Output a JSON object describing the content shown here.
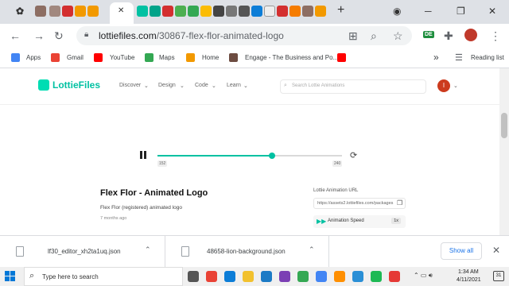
{
  "browser": {
    "active_tab_close": "✕",
    "new_tab": "+",
    "url_host": "lottiefiles.com",
    "url_path": "/30867-flex-flor-animated-logo",
    "bookmarks": [
      {
        "label": "Apps",
        "color": "#4285f4"
      },
      {
        "label": "Gmail",
        "color": "#ea4335"
      },
      {
        "label": "YouTube",
        "color": "#ff0000"
      },
      {
        "label": "Maps",
        "color": "#34a853"
      },
      {
        "label": "Home",
        "color": "#f29900"
      },
      {
        "label": "Engage - The Business and Po...",
        "color": "#6d4c41"
      }
    ],
    "more_bookmarks": "»",
    "reading_list": "Reading list",
    "profile_badge": "DE"
  },
  "lottie": {
    "logo": "LottieFiles",
    "menu": [
      "Discover",
      "Design",
      "Code",
      "Learn"
    ],
    "search_placeholder": "Search Lottie Animations",
    "avatar_letter": "I",
    "player": {
      "start_frame": "152",
      "end_frame": "240",
      "progress": 0.62
    },
    "animation_title": "Flex Flor - Animated Logo",
    "animation_description": "Flex Flor (registered) animated logo",
    "animation_age": "7 months ago",
    "url_label": "Lottie Animation URL",
    "url_value": "https://assets2.lottiefiles.com/packages",
    "speed_label": "Animation Speed",
    "speed_value": "1x"
  },
  "downloads": {
    "items": [
      {
        "name": "lf30_editor_xh2ta1uq.json"
      },
      {
        "name": "48658-lion-background.json"
      }
    ],
    "show_all": "Show all"
  },
  "taskbar": {
    "search_placeholder": "Type here to search",
    "time": "1:34 AM",
    "date": "4/11/2021",
    "notifications": "31",
    "apps": [
      {
        "name": "task-view",
        "color": "#555555"
      },
      {
        "name": "chrome",
        "color": "#e94235"
      },
      {
        "name": "edge",
        "color": "#0c7dd7"
      },
      {
        "name": "file-explorer",
        "color": "#f2c12e"
      },
      {
        "name": "vscode",
        "color": "#1b7ac5"
      },
      {
        "name": "visual-studio",
        "color": "#7b3fb4"
      },
      {
        "name": "maps",
        "color": "#34a853"
      },
      {
        "name": "chrome-alt",
        "color": "#4285f4"
      },
      {
        "name": "sublime",
        "color": "#ff8f00"
      },
      {
        "name": "photos",
        "color": "#2a8fd6"
      },
      {
        "name": "spotify",
        "color": "#1db954"
      },
      {
        "name": "media",
        "color": "#e53935"
      }
    ]
  }
}
